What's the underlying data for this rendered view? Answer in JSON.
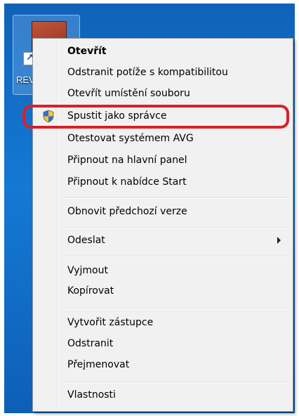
{
  "desktop_icon": {
    "label": "REV",
    "icon": "application-shortcut-icon",
    "overlay_icon": "shortcut-arrow-icon",
    "overlay_glyph": "↗"
  },
  "context_menu": {
    "items": [
      {
        "label": "Otevřít",
        "bold": true
      },
      {
        "label": "Odstranit potíže s kompatibilitou"
      },
      {
        "label": "Otevřít umístění souboru"
      },
      {
        "label": "Spustit jako správce",
        "icon": "uac-shield-icon",
        "highlighted": true
      },
      {
        "label": "Otestovat systémem AVG"
      },
      {
        "label": "Připnout na hlavní panel"
      },
      {
        "label": "Připnout k nabídce Start"
      },
      {
        "label": "Obnovit předchozí verze"
      },
      {
        "label": "Odeslat",
        "submenu": true
      },
      {
        "label": "Vyjmout"
      },
      {
        "label": "Kopírovat"
      },
      {
        "label": "Vytvořit zástupce"
      },
      {
        "label": "Odstranit"
      },
      {
        "label": "Přejmenovat"
      },
      {
        "label": "Vlastnosti"
      }
    ]
  },
  "colors": {
    "desktop_blue": "#1479d4",
    "annotation_red": "#d8202a",
    "menu_background": "#f1f1f1"
  }
}
